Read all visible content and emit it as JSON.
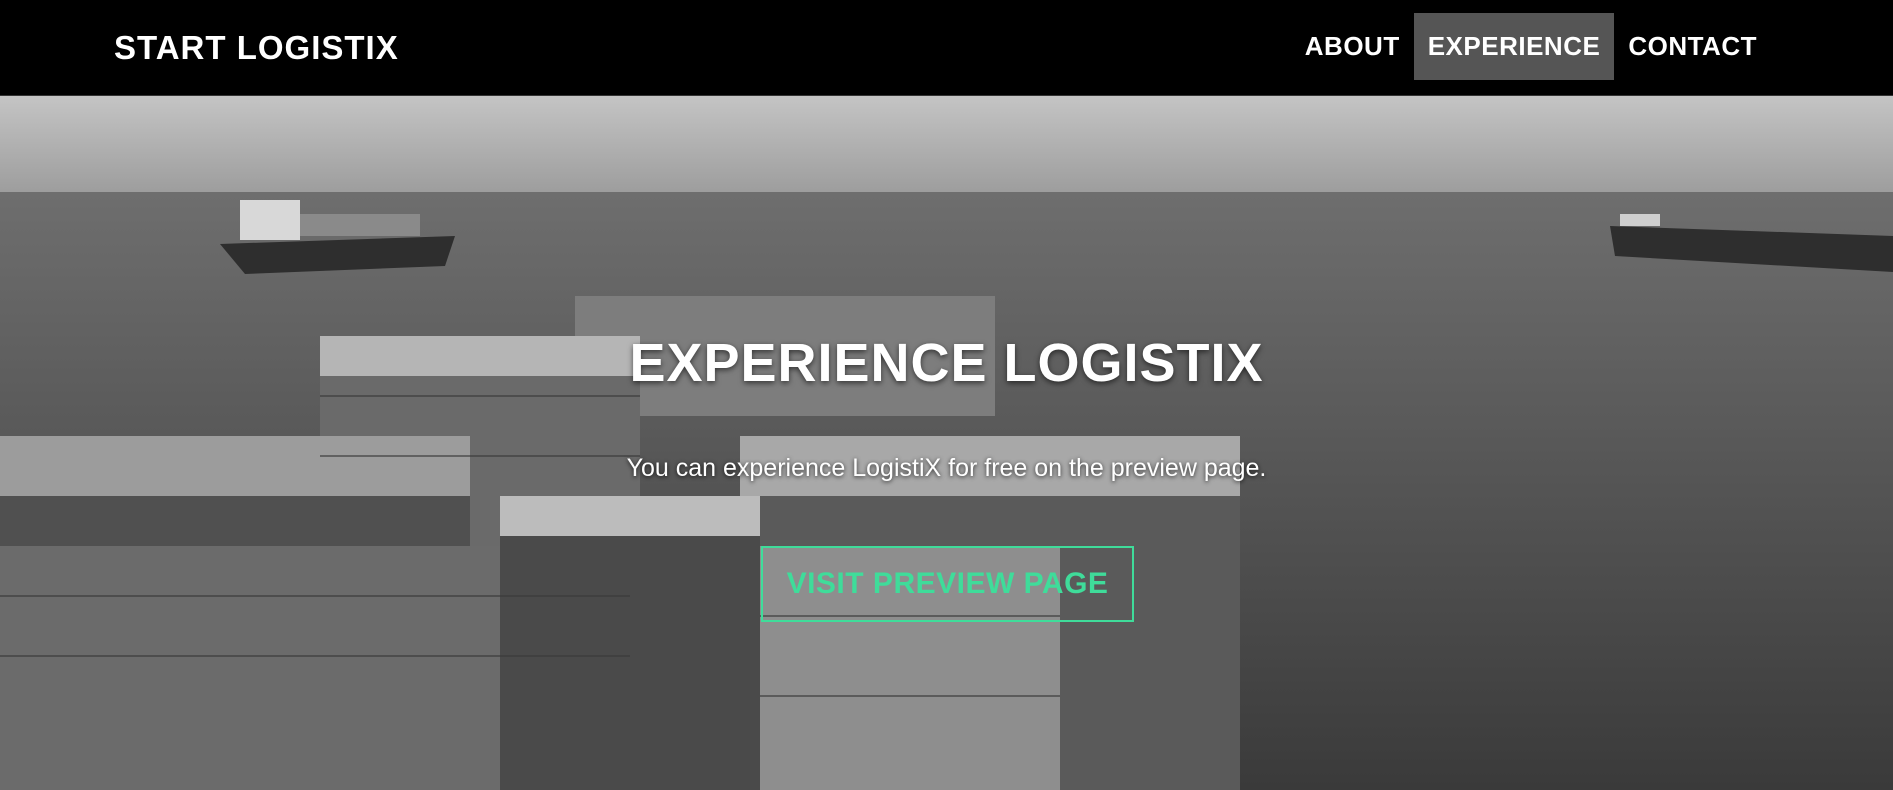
{
  "nav": {
    "brand": "START LOGISTIX",
    "links": [
      {
        "label": "ABOUT",
        "active": false
      },
      {
        "label": "EXPERIENCE",
        "active": true
      },
      {
        "label": "CONTACT",
        "active": false
      }
    ]
  },
  "hero": {
    "title": "EXPERIENCE LOGISTIX",
    "subtitle": "You can experience LogistiX for free on the preview page.",
    "cta_label": "VISIT PREVIEW PAGE",
    "background_icon": "container-ship-photo"
  },
  "colors": {
    "navbar_bg": "#000000",
    "active_link_bg": "#555555",
    "accent": "#3fdc9a",
    "text": "#ffffff"
  }
}
